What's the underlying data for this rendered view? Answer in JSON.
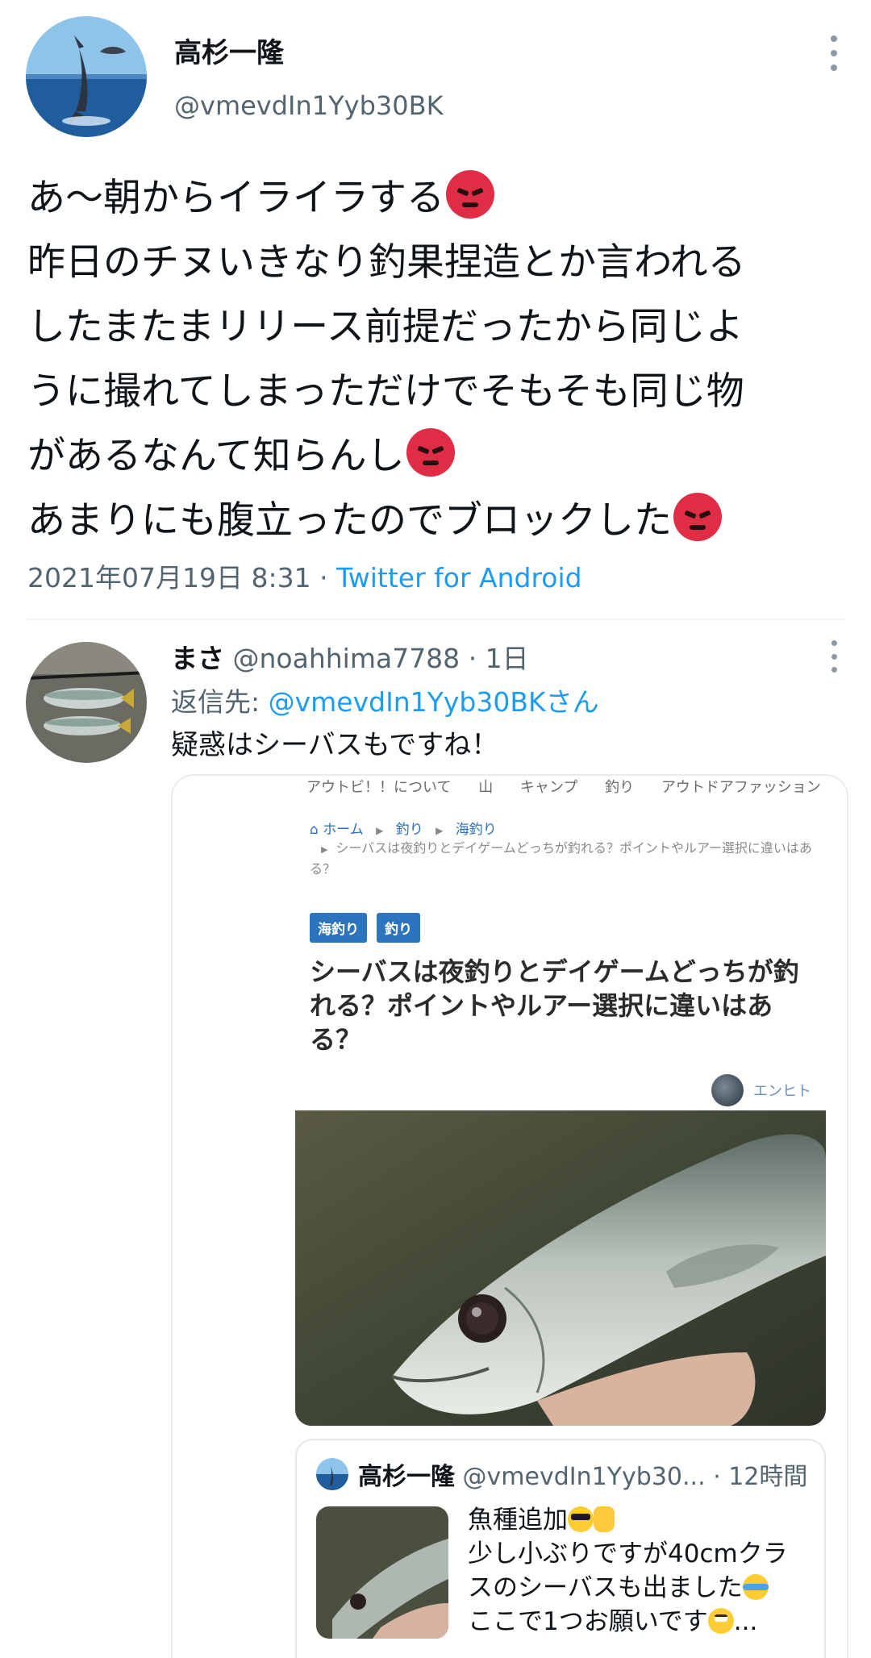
{
  "tweet": {
    "display_name": "高杉一隆",
    "handle": "@vmevdIn1Yyb30BK",
    "lines": [
      "あ〜朝からイライラする",
      "昨日のチヌいきなり釣果捏造とか言われる",
      "したまたまリリース前提だったから同じよ",
      "うに撮れてしまっただけでそもそも同じ物",
      "があるなんて知らんし",
      "あまりにも腹立ったのでブロックした"
    ],
    "date": "2021年07月19日 8:31",
    "separator": "·",
    "source": "Twitter for Android"
  },
  "reply": {
    "display_name": "まさ",
    "handle": "@noahhima7788",
    "time": "· 1日",
    "reply_to_label": "返信先: ",
    "reply_to_handle": "@vmevdIn1Yyb30BKさん",
    "text": "疑惑はシーバスもですね！"
  },
  "webpage": {
    "nav": [
      "アウトビ！！について",
      "山",
      "キャンプ",
      "釣り",
      "アウトドアファッション"
    ],
    "breadcrumb": [
      "ホーム",
      "釣り",
      "海釣り"
    ],
    "breadcrumb_sub": "シーバスは夜釣りとデイゲームどっちが釣れる？ポイントやルアー選択に違いはある？",
    "tags": [
      "海釣り",
      "釣り"
    ],
    "title": "シーバスは夜釣りとデイゲームどっちが釣れる？ポイントやルアー選択に違いはある？",
    "author": "エンヒト"
  },
  "quoted": {
    "display_name": "高杉一隆",
    "handle": "@vmevdIn1Yyb30...",
    "time": "· 12時間",
    "lines": [
      "魚種追加",
      "少し小ぶりですが40cmクラ",
      "スのシーバスも出ました",
      "ここで1つお願いです"
    ],
    "ellipsis": "..."
  },
  "icons": {
    "angry": "pouting-face-icon",
    "cool": "sunglasses-face-icon",
    "thumb": "thumbs-up-icon",
    "tears": "tears-of-joy-icon",
    "roll": "face-with-rolling-eyes-icon"
  },
  "colors": {
    "link": "#1d9bf0",
    "secondary_text": "#536471",
    "tag_bg": "#2d74bf"
  }
}
